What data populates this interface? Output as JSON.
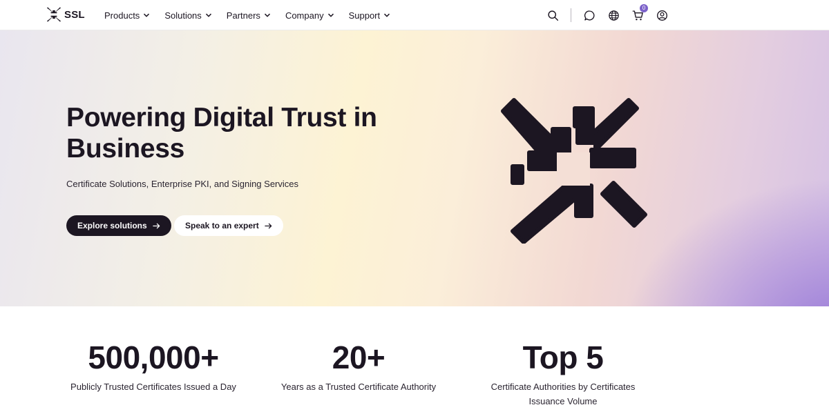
{
  "brand": {
    "name": "SSL",
    "logo_icon": "ssl-arrows-icon"
  },
  "nav": {
    "items": [
      {
        "label": "Products"
      },
      {
        "label": "Solutions"
      },
      {
        "label": "Partners"
      },
      {
        "label": "Company"
      },
      {
        "label": "Support"
      }
    ],
    "cart_count": "0",
    "icons": [
      "search-icon",
      "chat-icon",
      "globe-icon",
      "cart-icon",
      "account-icon"
    ]
  },
  "hero": {
    "title": "Powering Digital Trust in Business",
    "subtitle": "Certificate Solutions, Enterprise PKI, and Signing Services",
    "primary_cta": "Explore solutions",
    "secondary_cta": "Speak to an expert",
    "accent": "#1c1622"
  },
  "stats": [
    {
      "value": "500,000+",
      "label": "Publicly Trusted Certificates Issued a Day"
    },
    {
      "value": "20+",
      "label": "Years as a Trusted Certificate Authority"
    },
    {
      "value": "Top 5",
      "label": "Certificate Authorities by Certificates Issuance Volume"
    }
  ]
}
